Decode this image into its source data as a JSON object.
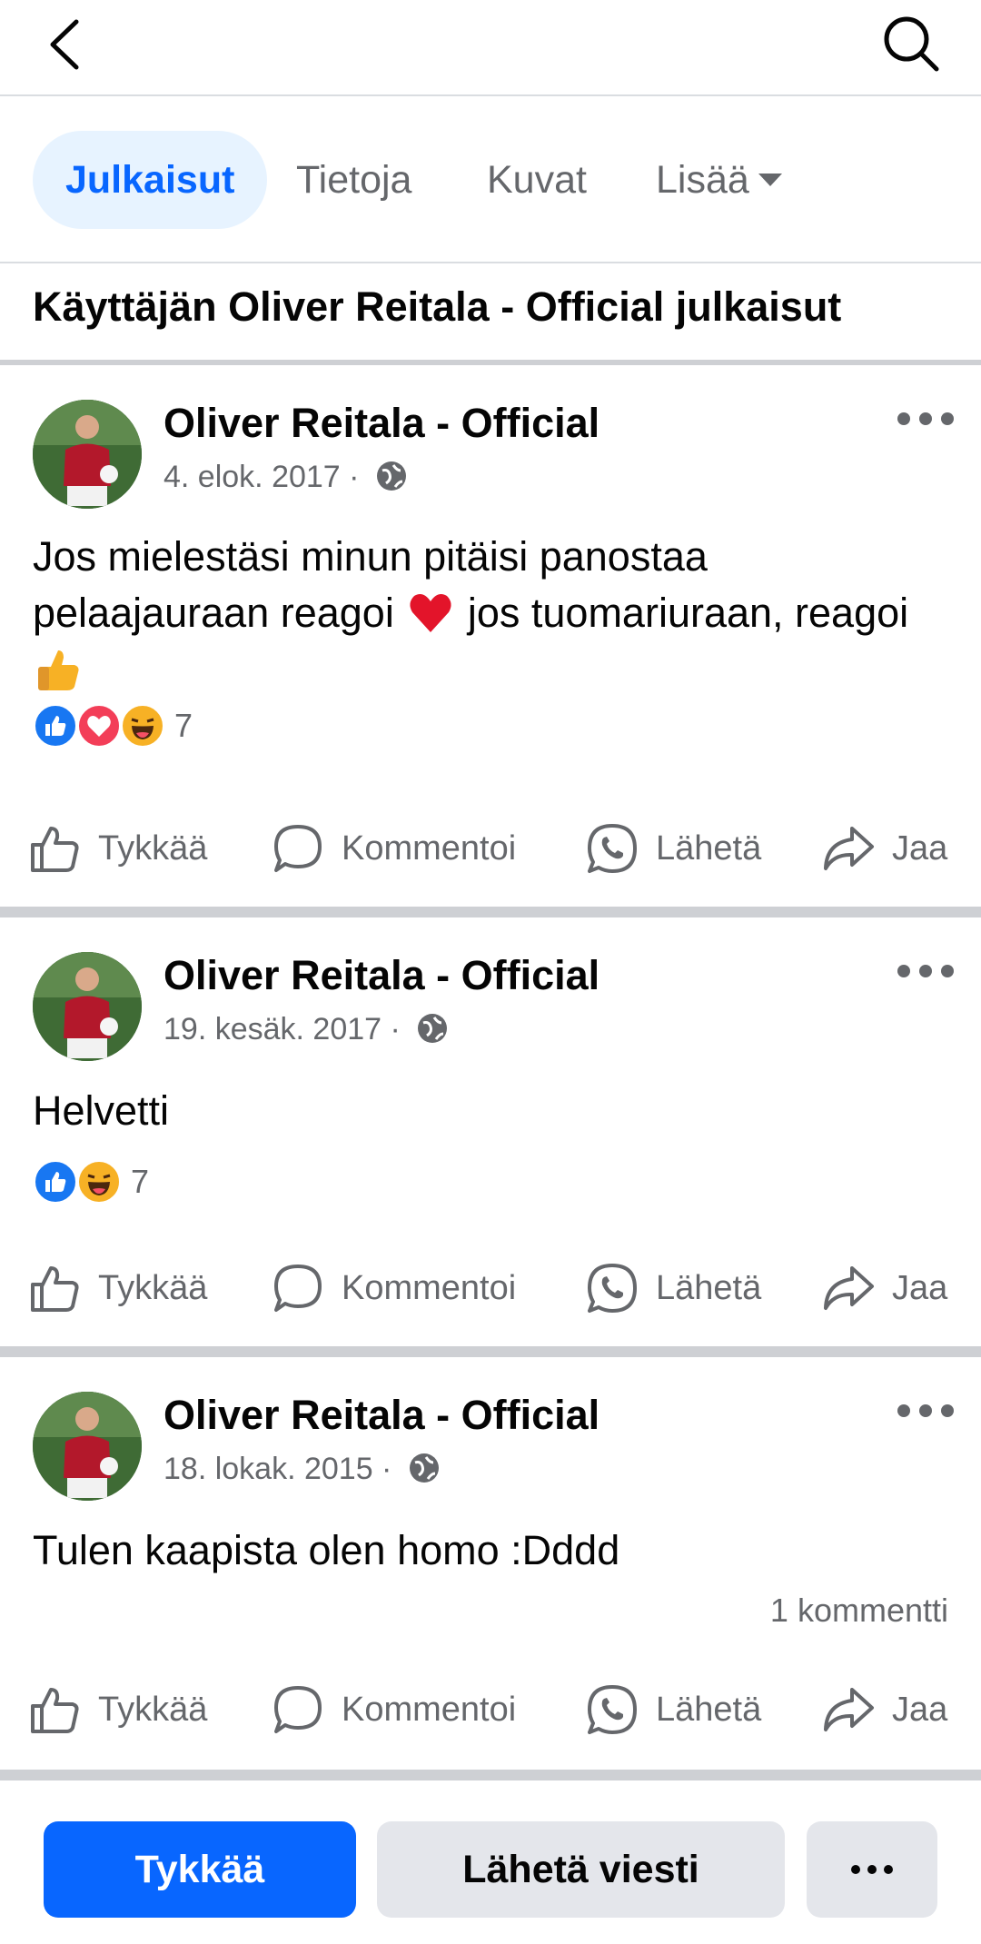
{
  "tabs": {
    "items": [
      {
        "label": "Julkaisut"
      },
      {
        "label": "Tietoja"
      },
      {
        "label": "Kuvat"
      },
      {
        "label": "Lisää"
      }
    ]
  },
  "section_title": "Käyttäjän Oliver Reitala - Official julkaisut",
  "posts": [
    {
      "author": "Oliver Reitala - Official",
      "date": "4. elok. 2017 ·",
      "text_1": "Jos mielestäsi minun pitäisi panostaa pelaajauraan reagoi",
      "text_2": "jos tuomariuraan, reagoi",
      "reactions": [
        "like",
        "love",
        "haha"
      ],
      "reaction_count": "7"
    },
    {
      "author": "Oliver Reitala - Official",
      "date": "19. kesäk. 2017 ·",
      "text": "Helvetti",
      "reactions": [
        "like",
        "haha"
      ],
      "reaction_count": "7"
    },
    {
      "author": "Oliver Reitala - Official",
      "date": "18. lokak. 2015 ·",
      "text": "Tulen kaapista olen homo :Dddd",
      "comment_count": "1 kommentti"
    }
  ],
  "actions": {
    "like": "Tykkää",
    "comment": "Kommentoi",
    "send": "Lähetä",
    "share": "Jaa"
  },
  "bottom": {
    "like_label": "Tykkää",
    "message_label": "Lähetä viesti"
  },
  "colors": {
    "accent": "#0866ff",
    "tab_active_bg": "#e7f3ff",
    "secondary_text": "#65676b",
    "button_gray": "#e4e6eb",
    "like_blue": "#1877f2",
    "love_red": "#f33e58",
    "haha_yellow": "#f7b125"
  }
}
